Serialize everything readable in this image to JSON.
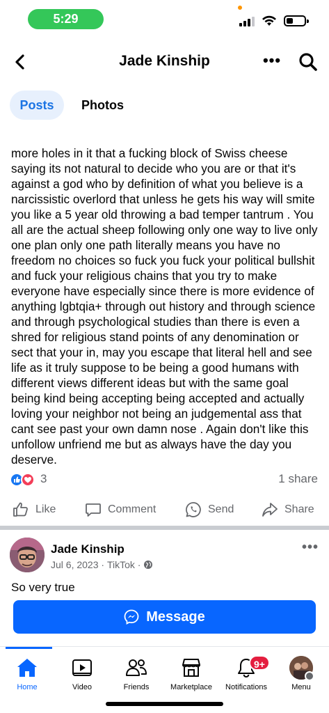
{
  "status_bar": {
    "time": "5:29"
  },
  "header": {
    "title": "Jade Kinship"
  },
  "tabs": [
    {
      "label": "Posts"
    },
    {
      "label": "Photos"
    }
  ],
  "post": {
    "text": "more holes in it that a fucking block of Swiss cheese saying its not natural to decide who you are or that it's against a god who by definition of what you believe is a narcissistic overlord that unless he gets his way will smite you like a 5 year old throwing a bad temper tantrum . You all are the actual sheep following only one way to live only one plan only one path literally means you have no freedom no choices so fuck you fuck your political  bullshit and fuck your religious chains that you try to make everyone have especially  since there is more evidence of anything lgbtqia+ through out history and through science and through psychological  studies than there is even a shred for religious  stand points of any denomination or sect that your in, may you escape that literal hell and see life as it truly suppose to be being a good humans with different views different ideas but with the same goal being kind being accepting being accepted and actually loving your neighbor not being an judgemental ass that cant see past your own damn nose . Again don't like this unfollow unfriend me but as always have the day you deserve.",
    "reaction_count": "3",
    "share_count": "1 share",
    "actions": {
      "like": "Like",
      "comment": "Comment",
      "send": "Send",
      "share": "Share"
    }
  },
  "post2": {
    "author": "Jade Kinship",
    "date": "Jul 6, 2023",
    "source": "TikTok",
    "text": "So very true"
  },
  "message_button": {
    "label": "Message"
  },
  "bottom_nav": {
    "items": [
      {
        "label": "Home"
      },
      {
        "label": "Video"
      },
      {
        "label": "Friends"
      },
      {
        "label": "Marketplace"
      },
      {
        "label": "Notifications",
        "badge": "9+"
      },
      {
        "label": "Menu"
      }
    ]
  },
  "colors": {
    "accent": "#0866ff",
    "tab_active_bg": "#e7f0fd",
    "badge": "#e41e3f",
    "time_pill": "#34c759"
  }
}
